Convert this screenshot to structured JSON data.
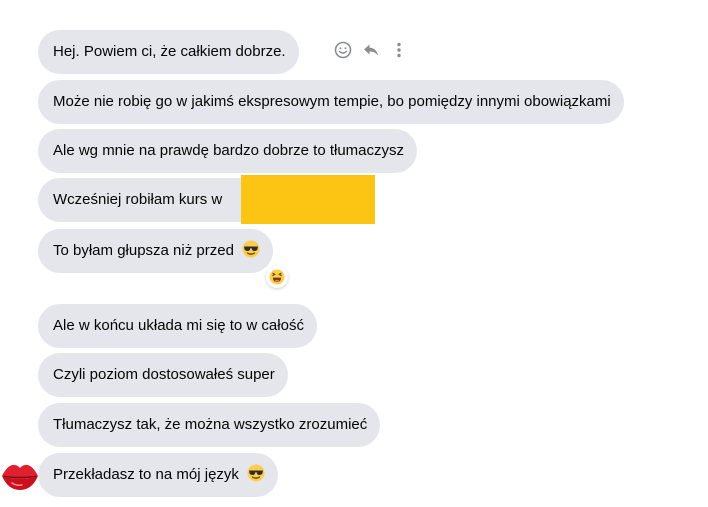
{
  "messages": [
    {
      "text": "Hej. Powiem ci, że całkiem dobrze.",
      "emoji": ""
    },
    {
      "text": "Może nie robię go w jakimś ekspresowym tempie, bo pomiędzy innymi obowiązkami",
      "emoji": ""
    },
    {
      "text": "Ale wg mnie na prawdę bardzo dobrze to tłumaczysz",
      "emoji": ""
    },
    {
      "text": "Wcześniej robiłam kurs w",
      "emoji": ""
    },
    {
      "text": "To byłam głupsza niż przed",
      "emoji": "smiling-face-with-sunglasses"
    },
    {
      "text": "Ale w końcu układa mi się to w całość",
      "emoji": ""
    },
    {
      "text": "Czyli poziom dostosowałeś super",
      "emoji": ""
    },
    {
      "text": "Tłumaczysz tak, że można wszystko zrozumieć",
      "emoji": ""
    },
    {
      "text": "Przekładasz to na mój język",
      "emoji": "smiling-face-with-sunglasses"
    }
  ],
  "message_actions": {
    "icons": [
      "smiley-react-icon",
      "reply-arrow-icon",
      "more-vertical-icon"
    ]
  },
  "reaction": {
    "icon": "laughing-emoji-icon"
  },
  "sender_avatar": {
    "icon": "lips-avatar-icon"
  },
  "colors": {
    "bubble_bg": "#e4e6eb",
    "text": "#050505",
    "redaction": "#fcc514",
    "icon_gray": "#8a8d91",
    "emoji_yellow": "#ffcc4d",
    "lips_red": "#e0202e"
  }
}
